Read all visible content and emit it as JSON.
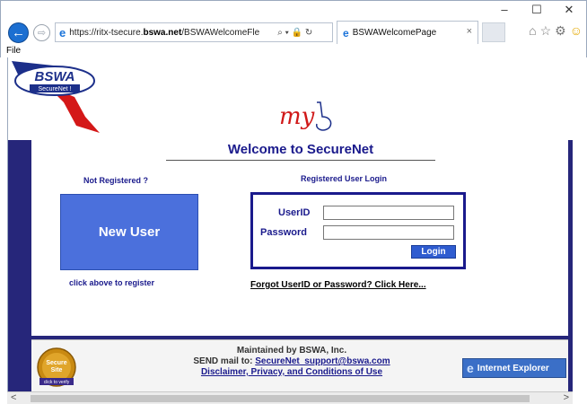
{
  "window": {
    "minimize": "–",
    "maximize": "☐",
    "close": "✕"
  },
  "browser": {
    "url_prefix": "https://ritx-tsecure.",
    "url_domain": "bswa.net",
    "url_suffix": "/BSWAWelcomeFle",
    "address_icons": "⌕ ▾ 🔒 ↻",
    "tab_title": "BSWAWelcomePage",
    "tab_close": "×",
    "menu": [
      "File"
    ],
    "toolbar_icons": [
      "⌂",
      "☆",
      "⚙",
      "☺"
    ]
  },
  "header": {
    "bswa_logo_text": "BSWA",
    "bswa_logo_sub": "SecureNet !",
    "my_logo_text": "my"
  },
  "welcome": {
    "title": "Welcome to SecureNet"
  },
  "left_panel": {
    "not_registered": "Not Registered ?",
    "new_user_button": "New User",
    "click_register": "click above to register"
  },
  "login": {
    "title": "Registered User Login",
    "userid_label": "UserID",
    "password_label": "Password",
    "userid_value": "",
    "password_value": "",
    "login_button": "Login",
    "forgot_link": "Forgot UserID or Password? Click Here..."
  },
  "footer": {
    "maintained": "Maintained by BSWA, Inc.",
    "send_mail": "SEND mail to:",
    "email": "SecureNet_support@bswa.com",
    "disclaimer": "Disclaimer, Privacy, and Conditions of Use",
    "seal_line1": "Secure",
    "seal_line2": "Site",
    "seal_line3": "click to verify",
    "ie_badge": "Internet Explorer"
  },
  "colors": {
    "navy": "#1a1a8c",
    "frame": "#26267a",
    "new_user_blue": "#4b70dc"
  }
}
